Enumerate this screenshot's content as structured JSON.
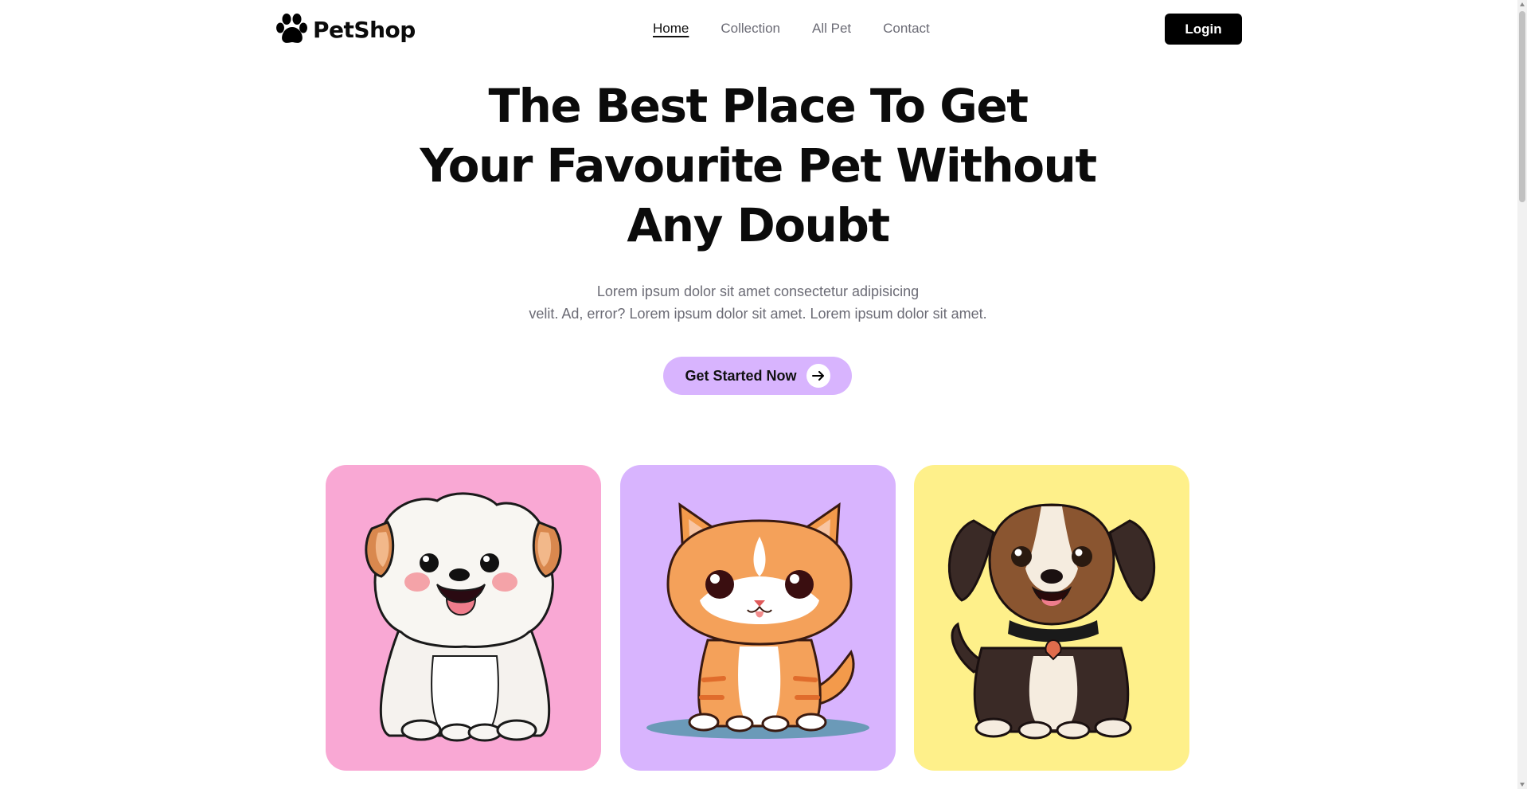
{
  "brand": {
    "name": "PetShop",
    "icon": "paw-icon"
  },
  "nav": {
    "items": [
      {
        "label": "Home",
        "active": true
      },
      {
        "label": "Collection",
        "active": false
      },
      {
        "label": "All Pet",
        "active": false
      },
      {
        "label": "Contact",
        "active": false
      }
    ],
    "login_label": "Login"
  },
  "hero": {
    "title_lines": [
      "The Best Place To Get",
      "Your Favourite Pet Without",
      "Any Doubt"
    ],
    "description_lines": [
      "Lorem ipsum dolor sit amet consectetur adipisicing",
      "velit. Ad, error? Lorem ipsum dolor sit amet. Lorem ipsum dolor sit amet."
    ],
    "cta_label": "Get Started Now",
    "cta_icon": "arrow-right-icon"
  },
  "cards": [
    {
      "pet": "white-puppy-illustration",
      "background": "#f9a8d4"
    },
    {
      "pet": "orange-kitten-illustration",
      "background": "#d8b4fe"
    },
    {
      "pet": "brown-dog-illustration",
      "background": "#fef08a"
    }
  ],
  "colors": {
    "accent": "#d8b4fe",
    "text": "#0b0b0b",
    "muted": "#6b6b75",
    "login_bg": "#000000"
  }
}
